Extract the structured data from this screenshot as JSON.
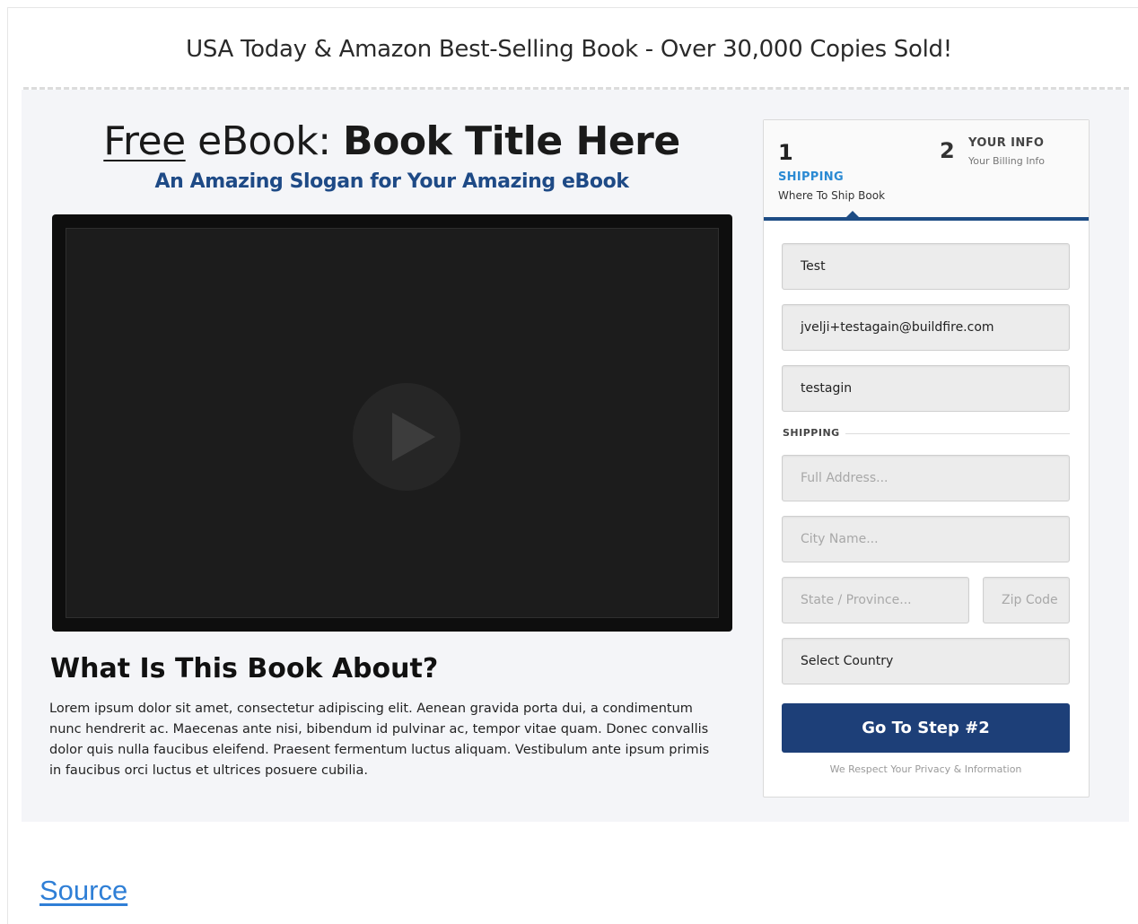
{
  "banner": {
    "text": "USA Today & Amazon Best-Selling Book - Over 30,000 Copies Sold!"
  },
  "hero": {
    "headline_free": "Free",
    "headline_mid": " eBook: ",
    "headline_bold": "Book Title Here",
    "slogan": "An Amazing Slogan for Your Amazing eBook"
  },
  "video": {
    "play_icon": "play-icon"
  },
  "about": {
    "title": "What Is This Book About?",
    "body": "Lorem ipsum dolor sit amet, consectetur adipiscing elit. Aenean gravida porta dui, a condimentum nunc hendrerit ac. Maecenas ante nisi, bibendum id pulvinar ac, tempor vitae quam. Donec convallis dolor quis nulla faucibus eleifend. Praesent fermentum luctus aliquam. Vestibulum ante ipsum primis in faucibus orci luctus et ultrices posuere cubilia."
  },
  "form": {
    "steps": [
      {
        "number": "1",
        "label": "SHIPPING",
        "sub": "Where To Ship Book",
        "active": true
      },
      {
        "number": "2",
        "label": "YOUR INFO",
        "sub": "Your Billing Info",
        "active": false
      }
    ],
    "fields": {
      "name": {
        "value": "Test"
      },
      "email": {
        "value": "jvelji+testagain@buildfire.com"
      },
      "phone": {
        "value": "testagin"
      },
      "address": {
        "placeholder": "Full Address..."
      },
      "city": {
        "placeholder": "City Name..."
      },
      "state": {
        "placeholder": "State / Province..."
      },
      "zip": {
        "placeholder": "Zip Code"
      },
      "country": {
        "value": "Select Country"
      }
    },
    "section_label": "SHIPPING",
    "submit_label": "Go To Step #2",
    "privacy": "We Respect Your Privacy & Information",
    "accent_color": "#1d3f78",
    "step_color": "#2a8ad3"
  },
  "source": {
    "label": "Source",
    "color": "#2f7fd6"
  }
}
